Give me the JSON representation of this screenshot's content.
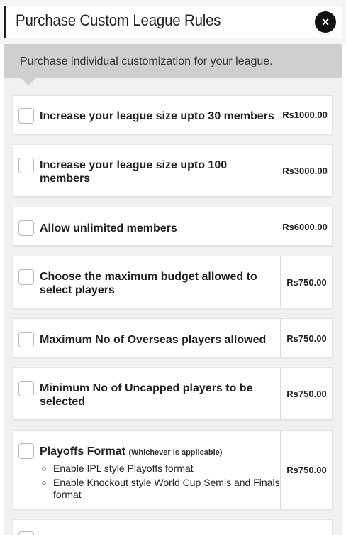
{
  "modal": {
    "title": "Purchase Custom League Rules",
    "close_label": "×",
    "banner_text": "Purchase individual customization for your league."
  },
  "items": [
    {
      "label": "Increase your league size upto 30 members",
      "price": "Rs1000.00"
    },
    {
      "label": "Increase your league size upto 100 members",
      "price": "Rs3000.00"
    },
    {
      "label": "Allow unlimited members",
      "price": "Rs6000.00"
    },
    {
      "label": "Choose the maximum budget allowed to select players",
      "price": "Rs750.00"
    },
    {
      "label": "Maximum No of Overseas players allowed",
      "price": "Rs750.00"
    },
    {
      "label": "Minimum No of Uncapped players to be selected",
      "price": "Rs750.00"
    },
    {
      "label": "Playoffs Format",
      "sublabel": "(Whichever is applicable)",
      "price": "Rs750.00",
      "options": [
        "Enable IPL style Playoffs format",
        "Enable Knockout style World Cup Semis and Finals format"
      ]
    }
  ],
  "colors": {
    "banner": "#cfcfcf",
    "close_button": "#111111",
    "list_background": "#f1f1f1"
  }
}
